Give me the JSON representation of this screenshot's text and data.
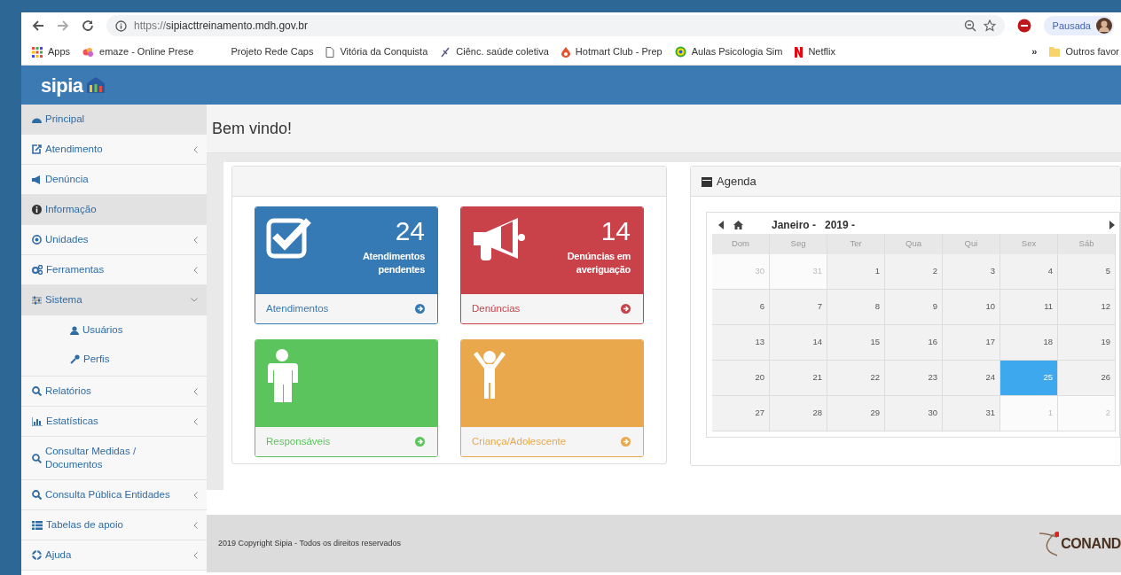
{
  "browser": {
    "url_scheme": "https://",
    "url_host": "sipiacttreinamento.mdh.gov.br",
    "profile_label": "Pausada",
    "bookmarks": [
      {
        "label": "Apps"
      },
      {
        "label": "emaze - Online Prese"
      },
      {
        "label": "Projeto Rede Caps"
      },
      {
        "label": "Vitória da Conquista"
      },
      {
        "label": "Ciênc. saúde coletiva"
      },
      {
        "label": "Hotmart Club - Prep"
      },
      {
        "label": "Aulas Psicologia Sim"
      },
      {
        "label": "Netflix"
      }
    ],
    "overflow": "»",
    "other_bookmarks": "Outros favor"
  },
  "app": {
    "logo": "sipia"
  },
  "sidebar": {
    "items": [
      {
        "kind": "link",
        "label": "Principal",
        "highlighted": true
      },
      {
        "kind": "menu",
        "label": "Atendimento",
        "highlighted": false,
        "expanded": false
      },
      {
        "kind": "link",
        "label": "Denúncia",
        "highlighted": false
      },
      {
        "kind": "link",
        "label": "Informação",
        "highlighted": true
      },
      {
        "kind": "menu",
        "label": "Unidades",
        "highlighted": false,
        "expanded": false
      },
      {
        "kind": "menu",
        "label": "Ferramentas",
        "highlighted": false,
        "expanded": false
      },
      {
        "kind": "menu",
        "label": "Sistema",
        "highlighted": true,
        "expanded": true,
        "children": [
          {
            "label": "Usuários"
          },
          {
            "label": "Perfis"
          }
        ]
      },
      {
        "kind": "menu",
        "label": "Relatórios",
        "highlighted": false,
        "expanded": false
      },
      {
        "kind": "menu",
        "label": "Estatísticas",
        "highlighted": false,
        "expanded": false
      },
      {
        "kind": "link",
        "label": "Consultar Medidas / Documentos",
        "highlighted": false
      },
      {
        "kind": "menu",
        "label": "Consulta Pública Entidades",
        "highlighted": false,
        "expanded": false
      },
      {
        "kind": "menu",
        "label": "Tabelas de apoio",
        "highlighted": false,
        "expanded": false
      },
      {
        "kind": "menu",
        "label": "Ajuda",
        "highlighted": false,
        "expanded": false
      }
    ]
  },
  "page_title": "Bem vindo!",
  "tiles": [
    {
      "kind": "check",
      "color": "#367ab5",
      "count": "24",
      "caption": "Atendimentos pendentes",
      "link": "Atendimentos"
    },
    {
      "kind": "megaphone",
      "color": "#c9424a",
      "count": "14",
      "caption": "Denúncias em averiguação",
      "link": "Denúncias"
    },
    {
      "kind": "adult",
      "color": "#5cc45d",
      "link": "Responsáveis"
    },
    {
      "kind": "child",
      "color": "#e9a84b",
      "link": "Criança/Adolescente"
    }
  ],
  "agenda": {
    "title": "Agenda",
    "month": "Janeiro -",
    "year": "2019 -",
    "weekdays": [
      "Dom",
      "Seg",
      "Ter",
      "Qua",
      "Qui",
      "Sex",
      "Sáb"
    ],
    "weeks": [
      [
        {
          "day": "30",
          "muted": true,
          "selected": false
        },
        {
          "day": "31",
          "muted": true,
          "selected": false
        },
        {
          "day": "1",
          "muted": false,
          "selected": false
        },
        {
          "day": "2",
          "muted": false,
          "selected": false
        },
        {
          "day": "3",
          "muted": false,
          "selected": false
        },
        {
          "day": "4",
          "muted": false,
          "selected": false
        },
        {
          "day": "5",
          "muted": false,
          "selected": false
        }
      ],
      [
        {
          "day": "6",
          "muted": false,
          "selected": false
        },
        {
          "day": "7",
          "muted": false,
          "selected": false
        },
        {
          "day": "8",
          "muted": false,
          "selected": false
        },
        {
          "day": "9",
          "muted": false,
          "selected": false
        },
        {
          "day": "10",
          "muted": false,
          "selected": false
        },
        {
          "day": "11",
          "muted": false,
          "selected": false
        },
        {
          "day": "12",
          "muted": false,
          "selected": false
        }
      ],
      [
        {
          "day": "13",
          "muted": false,
          "selected": false
        },
        {
          "day": "14",
          "muted": false,
          "selected": false
        },
        {
          "day": "15",
          "muted": false,
          "selected": false
        },
        {
          "day": "16",
          "muted": false,
          "selected": false
        },
        {
          "day": "17",
          "muted": false,
          "selected": false
        },
        {
          "day": "18",
          "muted": false,
          "selected": false
        },
        {
          "day": "19",
          "muted": false,
          "selected": false
        }
      ],
      [
        {
          "day": "20",
          "muted": false,
          "selected": false
        },
        {
          "day": "21",
          "muted": false,
          "selected": false
        },
        {
          "day": "22",
          "muted": false,
          "selected": false
        },
        {
          "day": "23",
          "muted": false,
          "selected": false
        },
        {
          "day": "24",
          "muted": false,
          "selected": false
        },
        {
          "day": "25",
          "muted": false,
          "selected": true
        },
        {
          "day": "26",
          "muted": false,
          "selected": false
        }
      ],
      [
        {
          "day": "27",
          "muted": false,
          "selected": false
        },
        {
          "day": "28",
          "muted": false,
          "selected": false
        },
        {
          "day": "29",
          "muted": false,
          "selected": false
        },
        {
          "day": "30",
          "muted": false,
          "selected": false
        },
        {
          "day": "31",
          "muted": false,
          "selected": false
        },
        {
          "day": "1",
          "muted": true,
          "selected": false
        },
        {
          "day": "2",
          "muted": true,
          "selected": false
        }
      ]
    ]
  },
  "footer": {
    "copyright": "2019 Copyright Sipia - Todos os direitos reservados",
    "partner_logo": "CONAND"
  }
}
